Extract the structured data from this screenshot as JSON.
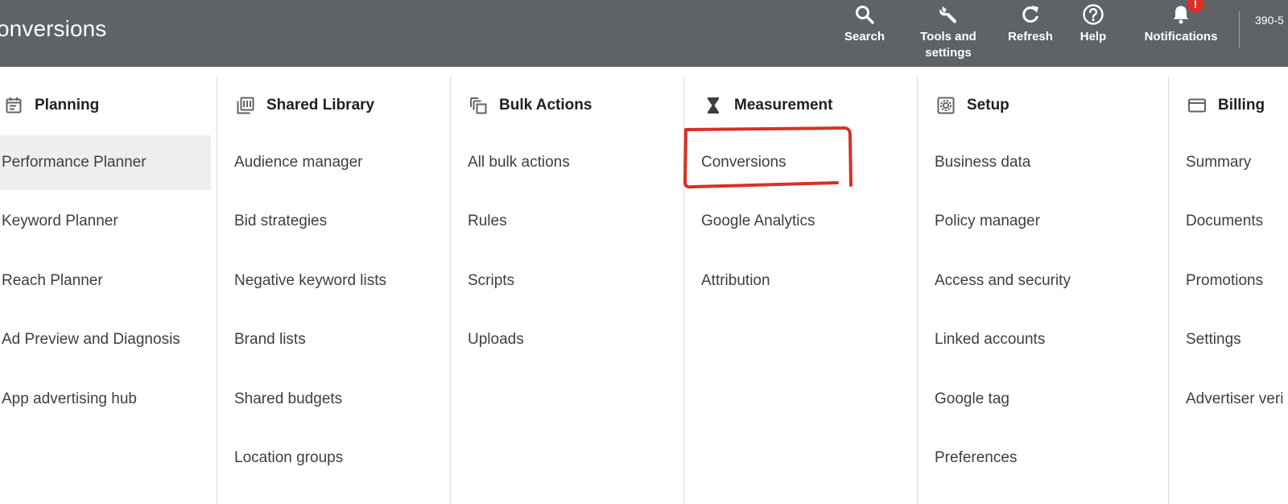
{
  "header": {
    "title": "onversions",
    "account_id": "390-5",
    "tools": [
      {
        "label": "Search",
        "icon": "search-icon"
      },
      {
        "label": "Tools and settings",
        "icon": "wrench-icon"
      },
      {
        "label": "Refresh",
        "icon": "refresh-icon"
      },
      {
        "label": "Help",
        "icon": "help-icon"
      },
      {
        "label": "Notifications",
        "icon": "bell-icon",
        "badge": "!"
      }
    ]
  },
  "columns": [
    {
      "heading": "Planning",
      "icon": "calendar-icon",
      "items": [
        "Performance Planner",
        "Keyword Planner",
        "Reach Planner",
        "Ad Preview and Diagnosis",
        "App advertising hub"
      ],
      "active_index": 0
    },
    {
      "heading": "Shared Library",
      "icon": "library-icon",
      "items": [
        "Audience manager",
        "Bid strategies",
        "Negative keyword lists",
        "Brand lists",
        "Shared budgets",
        "Location groups"
      ]
    },
    {
      "heading": "Bulk Actions",
      "icon": "copy-icon",
      "items": [
        "All bulk actions",
        "Rules",
        "Scripts",
        "Uploads"
      ]
    },
    {
      "heading": "Measurement",
      "icon": "hourglass-icon",
      "items": [
        "Conversions",
        "Google Analytics",
        "Attribution"
      ],
      "highlighted_index": 0
    },
    {
      "heading": "Setup",
      "icon": "settings-box-icon",
      "items": [
        "Business data",
        "Policy manager",
        "Access and security",
        "Linked accounts",
        "Google tag",
        "Preferences"
      ]
    },
    {
      "heading": "Billing",
      "icon": "credit-card-icon",
      "items": [
        "Summary",
        "Documents",
        "Promotions",
        "Settings",
        "Advertiser veri"
      ]
    }
  ],
  "colors": {
    "topbar_bg": "#5f6368",
    "active_item_bg": "#eeeeee",
    "annotation": "#d93025",
    "badge": "#d93025"
  }
}
